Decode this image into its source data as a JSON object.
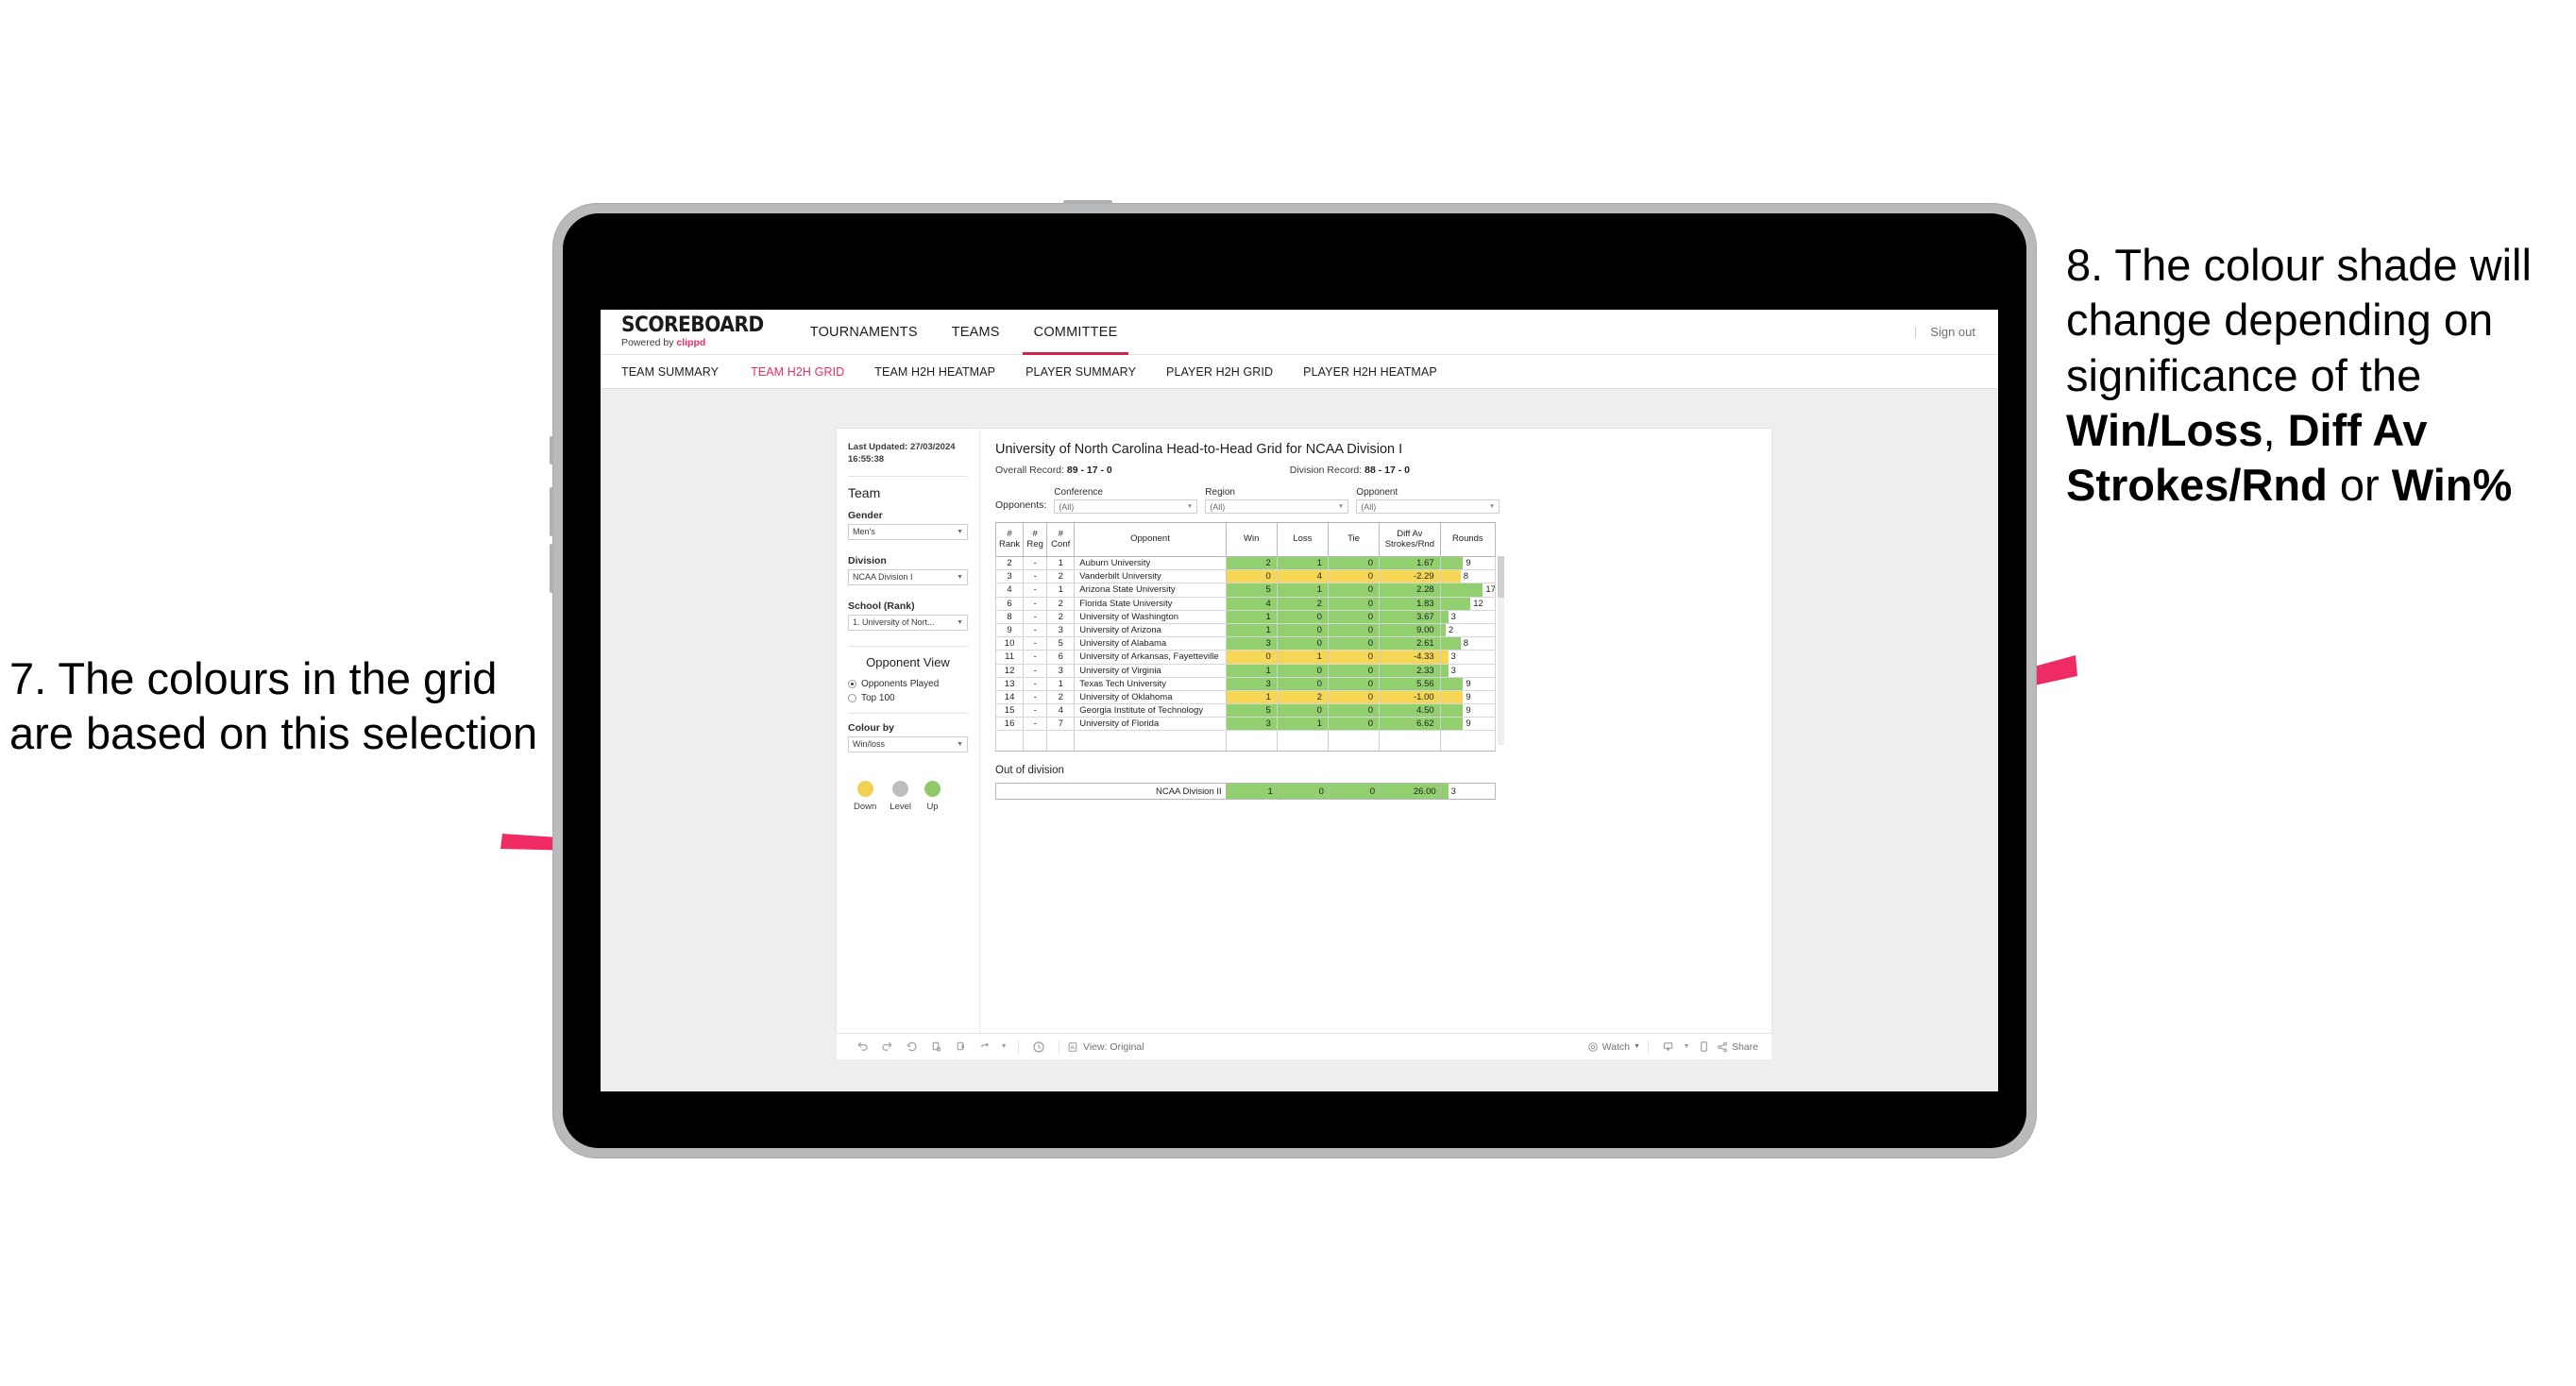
{
  "annotations": {
    "left": "7. The colours in the grid are based on this selection",
    "right_pre": "8. The colour shade will change depending on significance of the ",
    "right_b1": "Win/Loss",
    "right_mid1": ", ",
    "right_b2": "Diff Av Strokes/Rnd",
    "right_mid2": " or ",
    "right_b3": "Win%",
    "arrow_color": "#ef2b63"
  },
  "topnav": {
    "logo": "SCOREBOARD",
    "logo_sub_prefix": "Powered by ",
    "logo_brand": "clippd",
    "items": [
      {
        "label": "TOURNAMENTS",
        "active": false
      },
      {
        "label": "TEAMS",
        "active": false
      },
      {
        "label": "COMMITTEE",
        "active": true
      }
    ],
    "divider": "|",
    "signout": "Sign out"
  },
  "subnav": {
    "items": [
      {
        "label": "TEAM SUMMARY",
        "active": false
      },
      {
        "label": "TEAM H2H GRID",
        "active": true
      },
      {
        "label": "TEAM H2H HEATMAP",
        "active": false
      },
      {
        "label": "PLAYER SUMMARY",
        "active": false
      },
      {
        "label": "PLAYER H2H GRID",
        "active": false
      },
      {
        "label": "PLAYER H2H HEATMAP",
        "active": false
      }
    ]
  },
  "sidebar": {
    "last_updated": "Last Updated: 27/03/2024 16:55:38",
    "team_heading": "Team",
    "gender_label": "Gender",
    "gender_value": "Men's",
    "division_label": "Division",
    "division_value": "NCAA Division I",
    "school_label": "School (Rank)",
    "school_value": "1. University of Nort...",
    "opponent_view_heading": "Opponent View",
    "opponent_view_options": [
      {
        "label": "Opponents Played",
        "selected": true
      },
      {
        "label": "Top 100",
        "selected": false
      }
    ],
    "colour_by_label": "Colour by",
    "colour_by_value": "Win/loss",
    "legend": [
      {
        "caption": "Down",
        "color": "#f2d050"
      },
      {
        "caption": "Level",
        "color": "#bcbec0"
      },
      {
        "caption": "Up",
        "color": "#8fc866"
      }
    ]
  },
  "viz": {
    "title": "University of North Carolina Head-to-Head Grid for NCAA Division I",
    "overall_record_label": "Overall Record:",
    "overall_record_value": "89 - 17 - 0",
    "division_record_label": "Division Record:",
    "division_record_value": "88 - 17 - 0",
    "filters_lead": "Opponents:",
    "filters": [
      {
        "caption": "Conference",
        "value": "(All)"
      },
      {
        "caption": "Region",
        "value": "(All)"
      },
      {
        "caption": "Opponent",
        "value": "(All)"
      }
    ],
    "out_of_division_title": "Out of division"
  },
  "chart_data": {
    "type": "table",
    "title": "University of North Carolina Head-to-Head Grid for NCAA Division I",
    "columns": [
      "# Rank",
      "# Reg",
      "# Conf",
      "Opponent",
      "Win",
      "Loss",
      "Tie",
      "Diff Av Strokes/Rnd",
      "Rounds"
    ],
    "column_lines": [
      [
        "#",
        "Rank"
      ],
      [
        "#",
        "Reg"
      ],
      [
        "#",
        "Conf"
      ],
      [
        "",
        "Opponent"
      ],
      [
        "Win",
        ""
      ],
      [
        "Loss",
        ""
      ],
      [
        "Tie",
        ""
      ],
      [
        "Diff Av",
        "Strokes/Rnd"
      ],
      [
        "Rounds",
        ""
      ]
    ],
    "rounds_max": 17,
    "colors": {
      "up": "#92cf6e",
      "down": "#f5d755",
      "level": "#bcbec0"
    },
    "rows": [
      {
        "rank": "2",
        "reg": "-",
        "conf": "1",
        "opponent": "Auburn University",
        "win": "2",
        "loss": "1",
        "tie": "0",
        "diff": "1.67",
        "rounds": "9",
        "rounds_n": 9,
        "state": "up"
      },
      {
        "rank": "3",
        "reg": "-",
        "conf": "2",
        "opponent": "Vanderbilt University",
        "win": "0",
        "loss": "4",
        "tie": "0",
        "diff": "-2.29",
        "rounds": "8",
        "rounds_n": 8,
        "state": "down"
      },
      {
        "rank": "4",
        "reg": "-",
        "conf": "1",
        "opponent": "Arizona State University",
        "win": "5",
        "loss": "1",
        "tie": "0",
        "diff": "2.28",
        "rounds": "17",
        "rounds_n": 17,
        "state": "up"
      },
      {
        "rank": "6",
        "reg": "-",
        "conf": "2",
        "opponent": "Florida State University",
        "win": "4",
        "loss": "2",
        "tie": "0",
        "diff": "1.83",
        "rounds": "12",
        "rounds_n": 12,
        "state": "up"
      },
      {
        "rank": "8",
        "reg": "-",
        "conf": "2",
        "opponent": "University of Washington",
        "win": "1",
        "loss": "0",
        "tie": "0",
        "diff": "3.67",
        "rounds": "3",
        "rounds_n": 3,
        "state": "up"
      },
      {
        "rank": "9",
        "reg": "-",
        "conf": "3",
        "opponent": "University of Arizona",
        "win": "1",
        "loss": "0",
        "tie": "0",
        "diff": "9.00",
        "rounds": "2",
        "rounds_n": 2,
        "state": "up"
      },
      {
        "rank": "10",
        "reg": "-",
        "conf": "5",
        "opponent": "University of Alabama",
        "win": "3",
        "loss": "0",
        "tie": "0",
        "diff": "2.61",
        "rounds": "8",
        "rounds_n": 8,
        "state": "up"
      },
      {
        "rank": "11",
        "reg": "-",
        "conf": "6",
        "opponent": "University of Arkansas, Fayetteville",
        "win": "0",
        "loss": "1",
        "tie": "0",
        "diff": "-4.33",
        "rounds": "3",
        "rounds_n": 3,
        "state": "down"
      },
      {
        "rank": "12",
        "reg": "-",
        "conf": "3",
        "opponent": "University of Virginia",
        "win": "1",
        "loss": "0",
        "tie": "0",
        "diff": "2.33",
        "rounds": "3",
        "rounds_n": 3,
        "state": "up"
      },
      {
        "rank": "13",
        "reg": "-",
        "conf": "1",
        "opponent": "Texas Tech University",
        "win": "3",
        "loss": "0",
        "tie": "0",
        "diff": "5.56",
        "rounds": "9",
        "rounds_n": 9,
        "state": "up"
      },
      {
        "rank": "14",
        "reg": "-",
        "conf": "2",
        "opponent": "University of Oklahoma",
        "win": "1",
        "loss": "2",
        "tie": "0",
        "diff": "-1.00",
        "rounds": "9",
        "rounds_n": 9,
        "state": "down"
      },
      {
        "rank": "15",
        "reg": "-",
        "conf": "4",
        "opponent": "Georgia Institute of Technology",
        "win": "5",
        "loss": "0",
        "tie": "0",
        "diff": "4.50",
        "rounds": "9",
        "rounds_n": 9,
        "state": "up"
      },
      {
        "rank": "16",
        "reg": "-",
        "conf": "7",
        "opponent": "University of Florida",
        "win": "3",
        "loss": "1",
        "tie": "0",
        "diff": "6.62",
        "rounds": "9",
        "rounds_n": 9,
        "state": "up"
      }
    ],
    "out_of_division": [
      {
        "label": "NCAA Division II",
        "win": "1",
        "loss": "0",
        "tie": "0",
        "diff": "26.00",
        "rounds": "3",
        "rounds_n": 3,
        "state": "up"
      }
    ]
  },
  "toolbar": {
    "view_label": "View: Original",
    "watch_label": "Watch",
    "share_label": "Share",
    "icons": [
      "undo-icon",
      "redo-icon",
      "revert-icon",
      "refresh-icon",
      "pause-icon",
      "alerts-icon",
      "custom-views-icon",
      "watch-icon",
      "download-icon",
      "device-layout-icon",
      "share-icon"
    ]
  }
}
